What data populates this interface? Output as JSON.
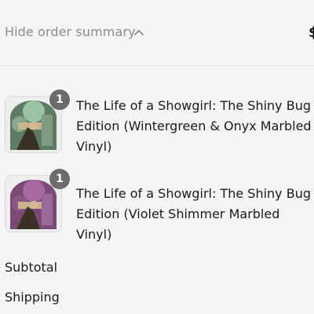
{
  "summary_toggle": {
    "label": "Hide order summary",
    "total_clipped": "$"
  },
  "items": [
    {
      "quantity": "1",
      "title": "The Life of a Showgirl: The Shiny Bug Edition (Wintergreen & Onyx Marbled Vinyl)",
      "vinyl_color": "#7aa88a"
    },
    {
      "quantity": "1",
      "title": "The Life of a Showgirl: The Shiny Bug Edition (Violet Shimmer Marbled Vinyl)",
      "vinyl_color": "#8a4f86"
    }
  ],
  "totals": {
    "subtotal_label": "Subtotal",
    "shipping_label": "Shipping"
  },
  "colors": {
    "badge": "#6b6b6b",
    "muted_text": "#8c8c8c"
  }
}
